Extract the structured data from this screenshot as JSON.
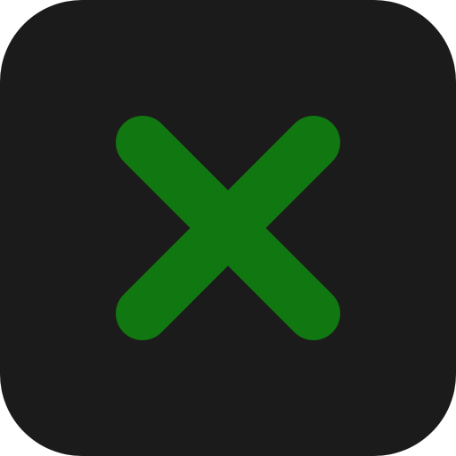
{
  "app_icon": {
    "icon": "close-icon",
    "colors": {
      "background": "#1b1b1b",
      "glyph": "#117811"
    }
  }
}
